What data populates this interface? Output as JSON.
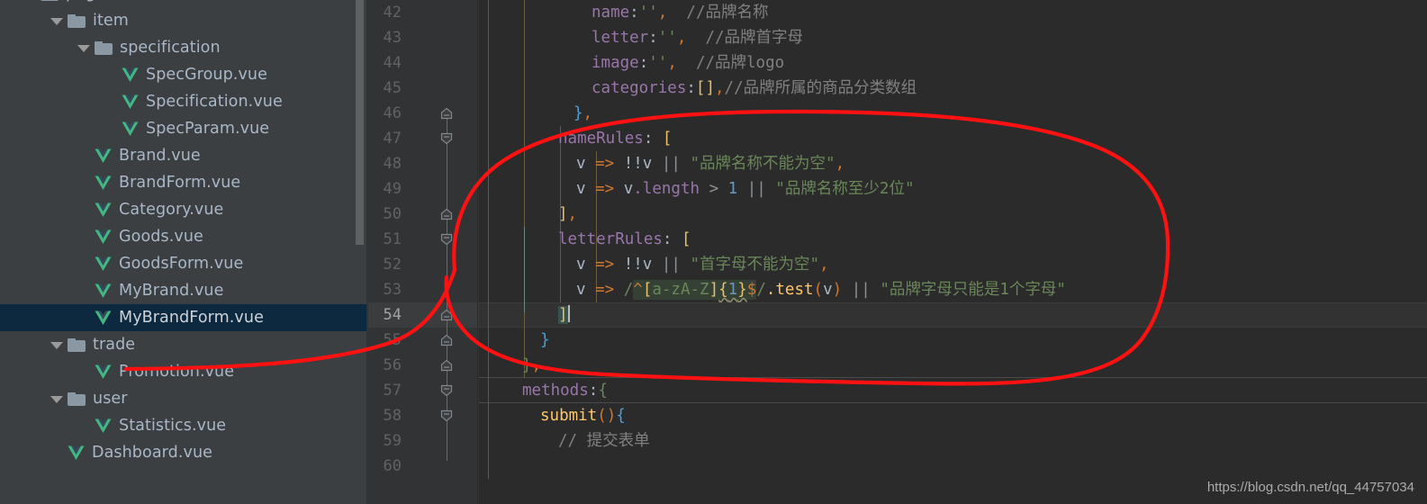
{
  "window": {
    "theme_bg": "#3c3f41",
    "editor_bg": "#2b2b2b",
    "accent_selection": "#0d293f",
    "annotation_color": "#ff0000"
  },
  "sidebar": {
    "name": "project-file-tree",
    "scrollbar_visible": true,
    "items": [
      {
        "label": "pages",
        "type": "folder",
        "depth": 1,
        "expanded": true,
        "selected": false,
        "icon": "folder-icon"
      },
      {
        "label": "item",
        "type": "folder",
        "depth": 2,
        "expanded": true,
        "selected": false,
        "icon": "folder-icon"
      },
      {
        "label": "specification",
        "type": "folder",
        "depth": 3,
        "expanded": true,
        "selected": false,
        "icon": "folder-icon"
      },
      {
        "label": "SpecGroup.vue",
        "type": "file",
        "depth": 4,
        "expanded": false,
        "selected": false,
        "icon": "vue-file-icon"
      },
      {
        "label": "Specification.vue",
        "type": "file",
        "depth": 4,
        "expanded": false,
        "selected": false,
        "icon": "vue-file-icon"
      },
      {
        "label": "SpecParam.vue",
        "type": "file",
        "depth": 4,
        "expanded": false,
        "selected": false,
        "icon": "vue-file-icon"
      },
      {
        "label": "Brand.vue",
        "type": "file",
        "depth": 3,
        "expanded": false,
        "selected": false,
        "icon": "vue-file-icon"
      },
      {
        "label": "BrandForm.vue",
        "type": "file",
        "depth": 3,
        "expanded": false,
        "selected": false,
        "icon": "vue-file-icon"
      },
      {
        "label": "Category.vue",
        "type": "file",
        "depth": 3,
        "expanded": false,
        "selected": false,
        "icon": "vue-file-icon"
      },
      {
        "label": "Goods.vue",
        "type": "file",
        "depth": 3,
        "expanded": false,
        "selected": false,
        "icon": "vue-file-icon"
      },
      {
        "label": "GoodsForm.vue",
        "type": "file",
        "depth": 3,
        "expanded": false,
        "selected": false,
        "icon": "vue-file-icon"
      },
      {
        "label": "MyBrand.vue",
        "type": "file",
        "depth": 3,
        "expanded": false,
        "selected": false,
        "icon": "vue-file-icon"
      },
      {
        "label": "MyBrandForm.vue",
        "type": "file",
        "depth": 3,
        "expanded": false,
        "selected": true,
        "icon": "vue-file-icon"
      },
      {
        "label": "trade",
        "type": "folder",
        "depth": 2,
        "expanded": true,
        "selected": false,
        "icon": "folder-icon"
      },
      {
        "label": "Promotion.vue",
        "type": "file",
        "depth": 3,
        "expanded": false,
        "selected": false,
        "icon": "vue-file-icon"
      },
      {
        "label": "user",
        "type": "folder",
        "depth": 2,
        "expanded": true,
        "selected": false,
        "icon": "folder-icon"
      },
      {
        "label": "Statistics.vue",
        "type": "file",
        "depth": 3,
        "expanded": false,
        "selected": false,
        "icon": "vue-file-icon"
      },
      {
        "label": "Dashboard.vue",
        "type": "file",
        "depth": 2,
        "expanded": false,
        "selected": false,
        "icon": "vue-file-icon"
      }
    ]
  },
  "editor": {
    "name": "code-editor",
    "language": "vue-javascript",
    "current_line": 54,
    "first_visible_line": 42,
    "last_visible_line": 60,
    "line_numbers": [
      42,
      43,
      44,
      45,
      46,
      47,
      48,
      49,
      50,
      51,
      52,
      53,
      54,
      55,
      56,
      57,
      58,
      59,
      60
    ],
    "lines": {
      "42": "name:'',  //品牌名称",
      "43": "letter:'',  //品牌首字母",
      "44": "image:'',  //品牌logo",
      "45": "categories:[],//品牌所属的商品分类数组",
      "46": "},",
      "47": "nameRules: [",
      "48": "v => !!v || \"品牌名称不能为空\",",
      "49": "v => v.length > 1 || \"品牌名称至少2位\"",
      "50": "],",
      "51": "letterRules: [",
      "52": "v => !!v || \"首字母不能为空\",",
      "53": "v => /^[a-zA-Z]{1}$/.test(v) || \"品牌字母只能是1个字母\"",
      "54": "]",
      "55": "}",
      "56": "},",
      "57": "methods:{",
      "58": "submit(){",
      "59": "// 提交表单",
      "60": ""
    },
    "tokens": {
      "prop_name": "name",
      "prop_letter": "letter",
      "prop_image": "image",
      "prop_categories": "categories",
      "prop_nameRules": "nameRules",
      "prop_letterRules": "letterRules",
      "prop_methods": "methods",
      "fn_submit": "submit",
      "comment_name": "//品牌名称",
      "comment_letter": "//品牌首字母",
      "comment_image": "//品牌logo",
      "comment_categories": "//品牌所属的商品分类数组",
      "comment_submit": "// 提交表单",
      "str_name_empty": "\"品牌名称不能为空\"",
      "str_name_min": "\"品牌名称至少2位\"",
      "str_letter_empty": "\"首字母不能为空\"",
      "str_letter_one": "\"品牌字母只能是1个字母\"",
      "regex_letter": "/^[a-zA-Z]{1}$/",
      "regex_inner_anchor_start": "^",
      "regex_inner_class": "[a-zA-Z]",
      "regex_inner_quant": "{1}",
      "regex_inner_anchor_end": "$",
      "method_test": ".test",
      "num_one": "1",
      "op_or": "||",
      "op_arrow": "=>",
      "op_not": "!!",
      "op_gt": ">",
      "var_v": "v",
      "prop_length": ".length"
    },
    "fold_markers": [
      {
        "line": 46,
        "state": "collapse-up"
      },
      {
        "line": 47,
        "state": "expanded"
      },
      {
        "line": 50,
        "state": "collapse-up"
      },
      {
        "line": 51,
        "state": "expanded"
      },
      {
        "line": 54,
        "state": "collapse-up"
      },
      {
        "line": 55,
        "state": "collapse-up"
      },
      {
        "line": 56,
        "state": "collapse-up"
      },
      {
        "line": 57,
        "state": "expanded"
      },
      {
        "line": 58,
        "state": "expanded"
      }
    ]
  },
  "annotation": {
    "name": "red-hand-drawn-oval",
    "shape": "oval-with-leader-line",
    "color": "#ff0000",
    "stroke_width": 4,
    "encircles_lines": [
      47,
      48,
      49,
      50,
      51,
      52,
      53,
      54
    ],
    "leader_from": "MyBrandForm.vue"
  },
  "watermark": {
    "text": "https://blog.csdn.net/qq_44757034"
  }
}
